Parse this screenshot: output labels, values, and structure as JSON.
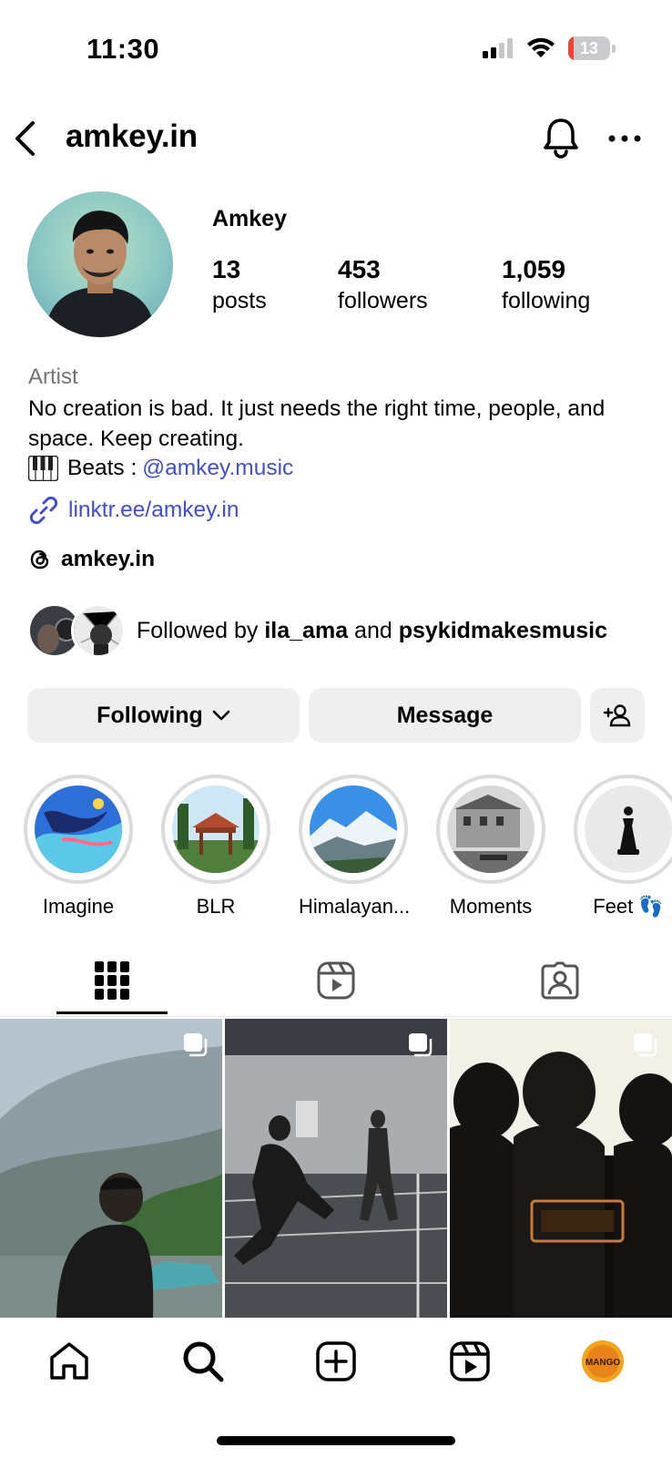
{
  "status_bar": {
    "time": "11:30",
    "battery_level": "13"
  },
  "header": {
    "username": "amkey.in"
  },
  "profile": {
    "display_name": "Amkey",
    "stats": [
      {
        "value": "13",
        "label": "posts"
      },
      {
        "value": "453",
        "label": "followers"
      },
      {
        "value": "1,059",
        "label": "following"
      }
    ],
    "category": "Artist",
    "bio": "No creation is bad. It just needs the right time, people, and space. Keep creating.",
    "beats_label": "Beats  :",
    "beats_mention": "@amkey.music",
    "link": "linktr.ee/amkey.in",
    "threads_handle": "amkey.in",
    "followed_by_prefix": "Followed by ",
    "followed_by_user1": "ila_ama",
    "followed_by_joiner": " and ",
    "followed_by_user2": "psykidmakesmusic"
  },
  "actions": {
    "following_label": "Following",
    "message_label": "Message"
  },
  "highlights": [
    {
      "label": "Imagine"
    },
    {
      "label": "BLR"
    },
    {
      "label": "Himalayan..."
    },
    {
      "label": "Moments"
    },
    {
      "label": "Feet 👣"
    }
  ],
  "tabs": [
    "grid-icon",
    "reels-icon",
    "tagged-icon"
  ],
  "nav": [
    "home-icon",
    "search-icon",
    "create-icon",
    "reels-icon",
    "profile-avatar"
  ],
  "nav_avatar_text": "MANGO",
  "colors": {
    "link": "#4150c8",
    "button_bg": "#efefef",
    "battery_low": "#f04438"
  }
}
